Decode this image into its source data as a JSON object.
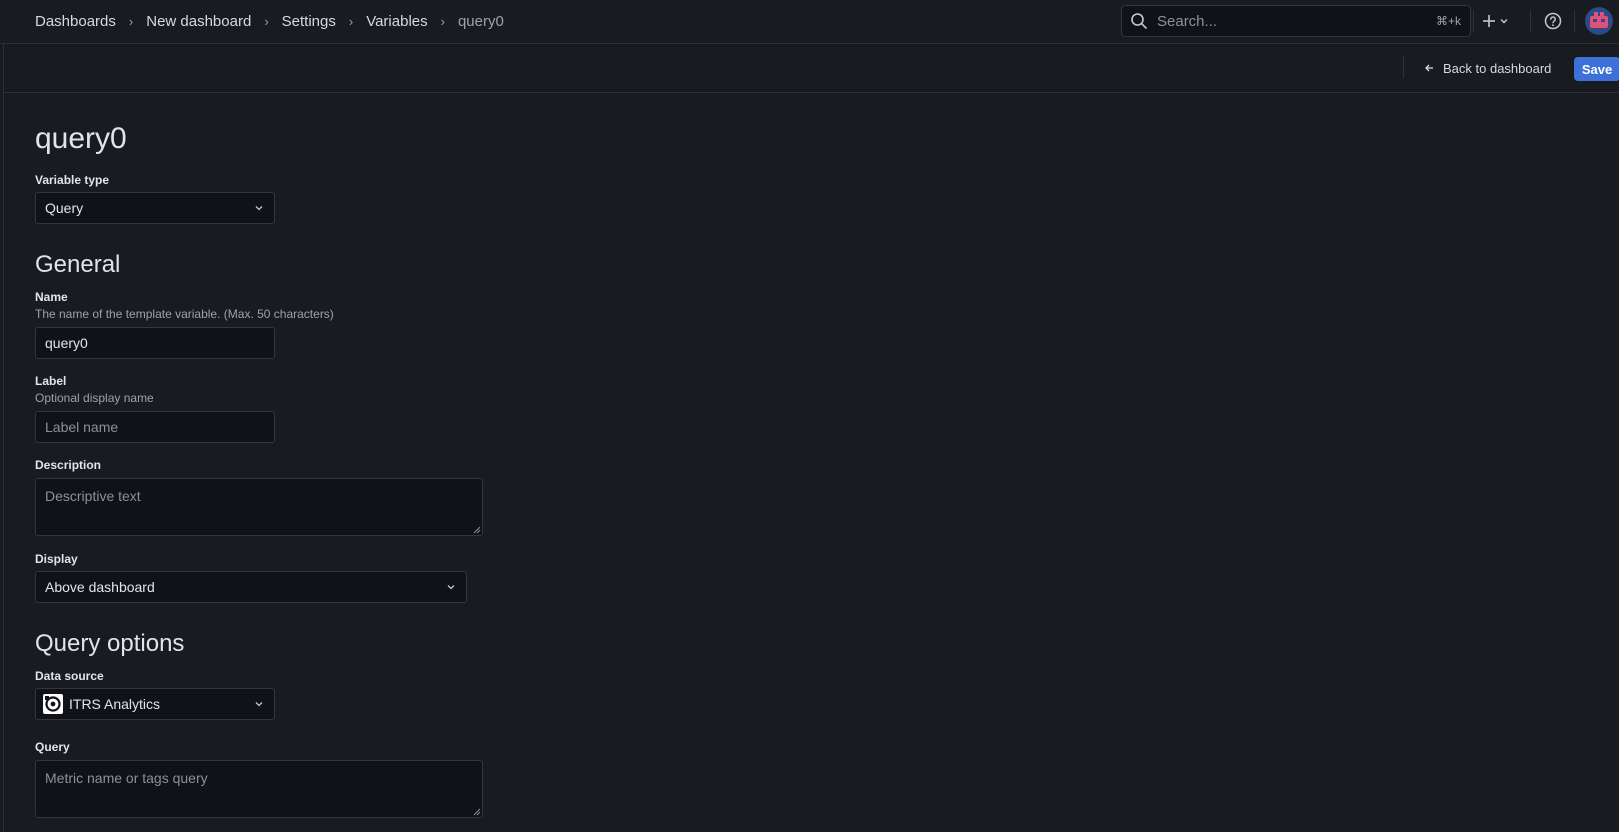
{
  "breadcrumb": {
    "items": [
      "Dashboards",
      "New dashboard",
      "Settings",
      "Variables"
    ],
    "current": "query0"
  },
  "search": {
    "placeholder": "Search...",
    "shortcut": "⌘+k"
  },
  "toolbar": {
    "back_label": "Back to dashboard",
    "save_label": "Save"
  },
  "page": {
    "title": "query0"
  },
  "variable_type": {
    "label": "Variable type",
    "value": "Query"
  },
  "general": {
    "title": "General",
    "name": {
      "label": "Name",
      "description": "The name of the template variable. (Max. 50 characters)",
      "value": "query0"
    },
    "label": {
      "label": "Label",
      "description": "Optional display name",
      "placeholder": "Label name"
    },
    "description": {
      "label": "Description",
      "placeholder": "Descriptive text"
    },
    "display": {
      "label": "Display",
      "value": "Above dashboard"
    }
  },
  "query_options": {
    "title": "Query options",
    "data_source": {
      "label": "Data source",
      "value": "ITRS Analytics"
    },
    "query": {
      "label": "Query",
      "placeholder": "Metric name or tags query"
    }
  },
  "colors": {
    "background": "#181b1f",
    "input_bg": "#111217",
    "primary": "#3d71d9"
  }
}
